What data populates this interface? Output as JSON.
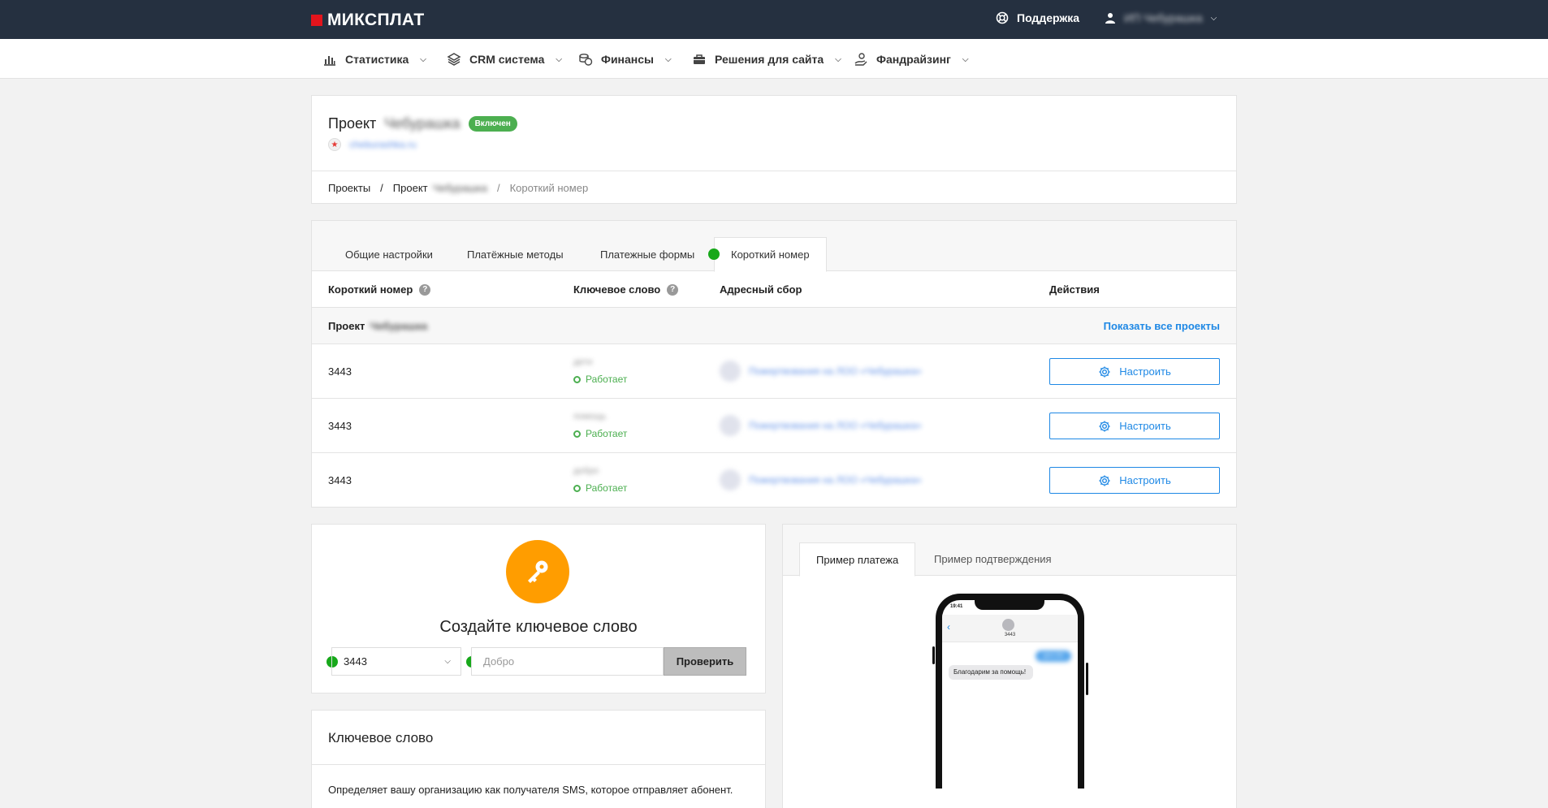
{
  "header": {
    "brand": "МИКСПЛАТ",
    "support_label": "Поддержка",
    "user_label": "ИП Чебурашка"
  },
  "nav": {
    "items": [
      {
        "label": "Статистика",
        "icon": "bar-chart-icon"
      },
      {
        "label": "CRM система",
        "icon": "layers-icon"
      },
      {
        "label": "Финансы",
        "icon": "coins-icon"
      },
      {
        "label": "Решения для сайта",
        "icon": "briefcase-icon"
      },
      {
        "label": "Фандрайзинг",
        "icon": "hand-coin-icon"
      }
    ]
  },
  "project": {
    "title_prefix": "Проект",
    "title_name": "Чебурашка",
    "status_badge": "Включен",
    "site_link": "cheburashka.ru",
    "breadcrumb": {
      "projects": "Проекты",
      "sep": "/",
      "project_prefix": "Проект",
      "project_name": "Чебурашка",
      "current": "Короткий номер"
    }
  },
  "tabs": {
    "items": [
      "Общие настройки",
      "Платёжные методы",
      "Платежные формы",
      "Короткий номер"
    ],
    "active": "Короткий номер"
  },
  "table": {
    "columns": {
      "short_number": "Короткий номер",
      "keyword": "Ключевое слово",
      "target_fund": "Адресный сбор",
      "actions": "Действия"
    },
    "help_glyph": "?",
    "group": {
      "title_prefix": "Проект",
      "title_name": "Чебурашка",
      "show_all_link": "Показать все проекты"
    },
    "rows": [
      {
        "number": "3443",
        "keyword": "дети",
        "status": "Работает",
        "fund": "Пожертвования на ЛОО «Чебурашка»",
        "action": "Настроить"
      },
      {
        "number": "3443",
        "keyword": "помощь",
        "status": "Работает",
        "fund": "Пожертвования на ЛОО «Чебурашка»",
        "action": "Настроить"
      },
      {
        "number": "3443",
        "keyword": "добро",
        "status": "Работает",
        "fund": "Пожертвования на ЛОО «Чебурашка»",
        "action": "Настроить"
      }
    ]
  },
  "create_keyword": {
    "title": "Создайте ключевое слово",
    "selected_number": "3443",
    "keyword_placeholder": "Добро",
    "check_button": "Проверить"
  },
  "keyword_info": {
    "title": "Ключевое слово",
    "text": "Определяет вашу организацию как получателя SMS, которое отправляет абонент."
  },
  "preview": {
    "tabs": [
      "Пример платежа",
      "Пример подтверждения"
    ],
    "active": "Пример платежа",
    "phone": {
      "time": "19:41",
      "sender": "3443",
      "outgoing": "дети 100",
      "incoming": "Благодарим за помощь!"
    }
  },
  "colors": {
    "topbar": "#253040",
    "brand_red": "#e3141c",
    "accent_blue": "#1e88e5",
    "status_green": "#4caf50",
    "dot_green": "#17a81a",
    "key_orange": "#ff9d00"
  }
}
